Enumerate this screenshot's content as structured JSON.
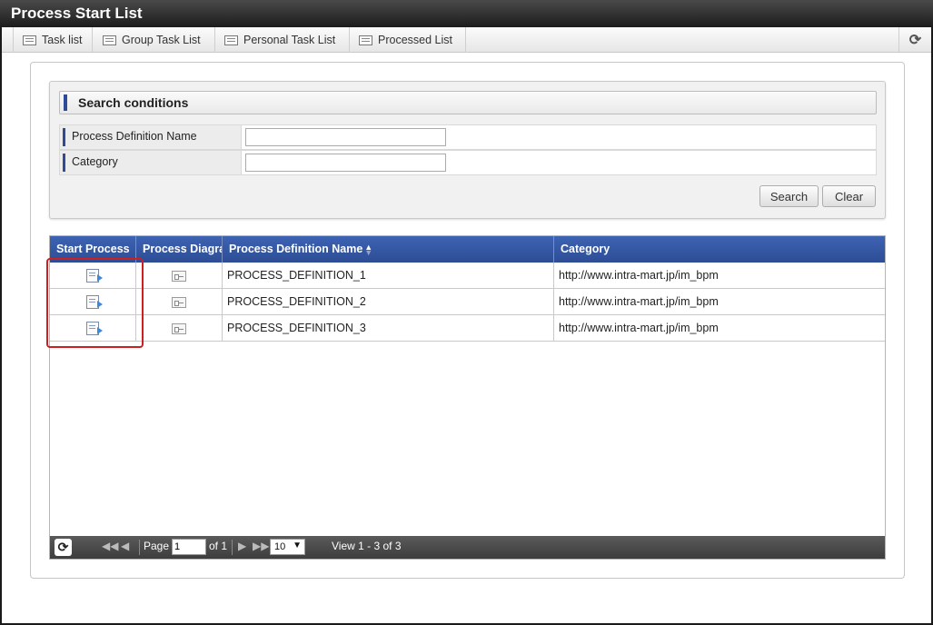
{
  "window": {
    "title": "Process Start List"
  },
  "tabs": [
    {
      "label": "Task list",
      "icon": "list-icon"
    },
    {
      "label": "Group Task List",
      "icon": "list-icon"
    },
    {
      "label": "Personal Task List",
      "icon": "list-icon"
    },
    {
      "label": "Processed List",
      "icon": "list-icon"
    }
  ],
  "toolbar": {
    "reload_icon": "⟳"
  },
  "search": {
    "title": "Search conditions",
    "fields": [
      {
        "label": "Process Definition Name",
        "value": "",
        "placeholder": ""
      },
      {
        "label": "Category",
        "value": "",
        "placeholder": ""
      }
    ],
    "search_label": "Search",
    "clear_label": "Clear"
  },
  "grid": {
    "columns": [
      "Start Process",
      "Process Diagram",
      "Process Definition Name",
      "Category"
    ],
    "sort_column": "Process Definition Name",
    "rows": [
      {
        "name": "PROCESS_DEFINITION_1",
        "category": "http://www.intra-mart.jp/im_bpm"
      },
      {
        "name": "PROCESS_DEFINITION_2",
        "category": "http://www.intra-mart.jp/im_bpm"
      },
      {
        "name": "PROCESS_DEFINITION_3",
        "category": "http://www.intra-mart.jp/im_bpm"
      }
    ]
  },
  "pager": {
    "page_label": "Page",
    "page_value": "1",
    "of_label": "of 1",
    "rows_per_page": "10",
    "view_text": "View 1 - 3 of 3"
  },
  "colors": {
    "accent": "#2f4a96",
    "header_bg": "#3d63b3",
    "highlight": "#cc1f1f"
  }
}
